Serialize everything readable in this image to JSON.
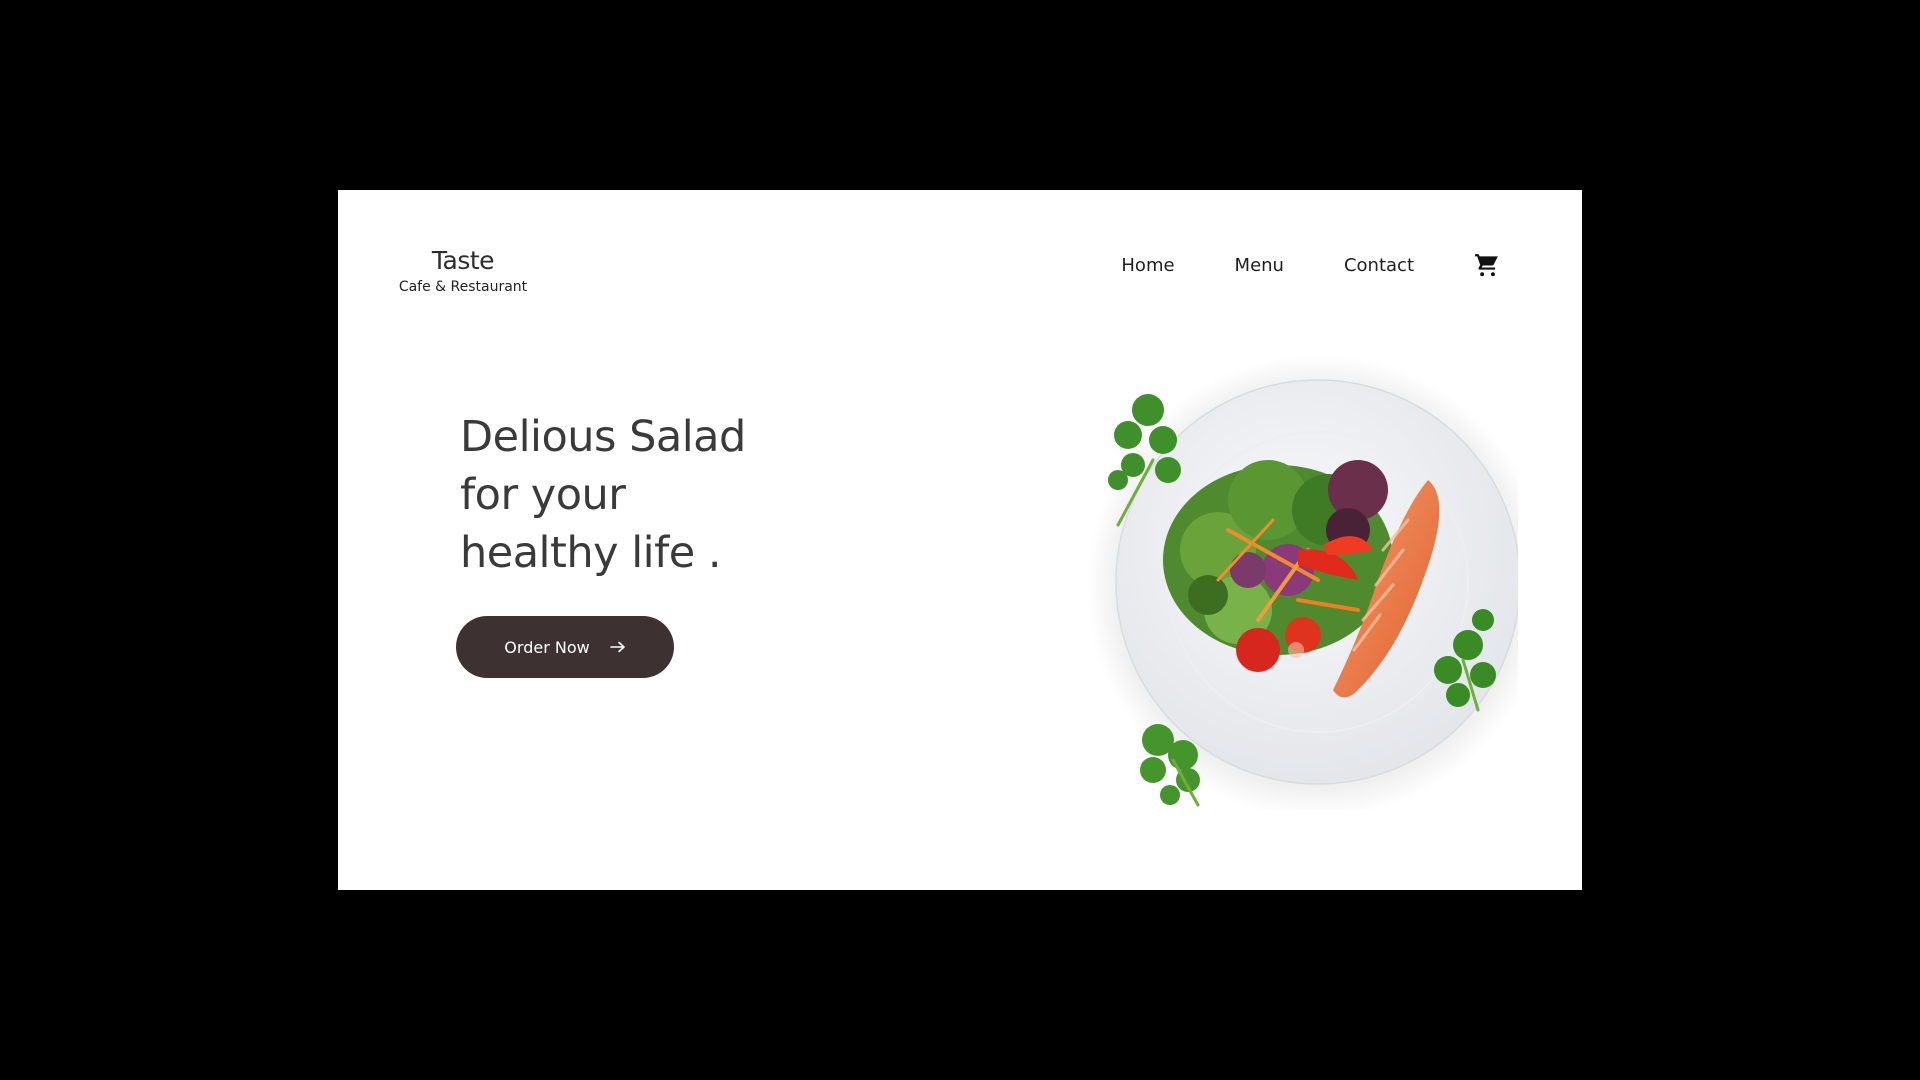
{
  "brand": {
    "name": "Taste",
    "tagline": "Cafe & Restaurant"
  },
  "nav": {
    "items": [
      "Home",
      "Menu",
      "Contact"
    ],
    "cart_icon": "shopping-cart-icon"
  },
  "hero": {
    "headline_lines": [
      "Delious Salad",
      "for your",
      "healthy life ."
    ],
    "cta_label": "Order Now",
    "cta_icon": "arrow-right-icon",
    "button_color": "#3e3132"
  },
  "image": {
    "subject": "salad-with-salmon-plate"
  }
}
